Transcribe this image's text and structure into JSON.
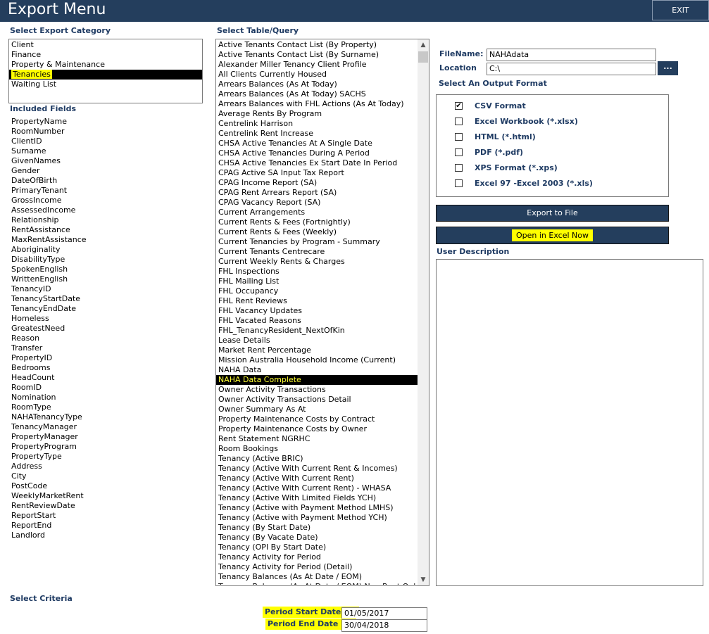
{
  "title": "Export Menu",
  "exit_label": "EXIT",
  "labels": {
    "category": "Select Export Category",
    "included": "Included Fields",
    "table": "Select Table/Query",
    "filename": "FileName:",
    "location": "Location",
    "output_format": "Select An Output Format",
    "user_description": "User Description",
    "criteria": "Select Criteria"
  },
  "categories": [
    "Client",
    "Finance",
    "Property & Maintenance",
    "Tenancies",
    "Waiting List"
  ],
  "selected_category": "Tenancies",
  "fields": [
    "PropertyName",
    "RoomNumber",
    "ClientID",
    "Surname",
    "GivenNames",
    "Gender",
    "DateOfBirth",
    "PrimaryTenant",
    "GrossIncome",
    "AssessedIncome",
    "Relationship",
    "RentAssistance",
    "MaxRentAssistance",
    "Aboriginality",
    "DisabilityType",
    "SpokenEnglish",
    "WrittenEnglish",
    "TenancyID",
    "TenancyStartDate",
    "TenancyEndDate",
    "Homeless",
    "GreatestNeed",
    "Reason",
    "Transfer",
    "PropertyID",
    "Bedrooms",
    "HeadCount",
    "RoomID",
    "Nomination",
    "RoomType",
    "NAHATenancyType",
    "TenancyManager",
    "PropertyManager",
    "PropertyProgram",
    "PropertyType",
    "Address",
    "City",
    "PostCode",
    "WeeklyMarketRent",
    "RentReviewDate",
    "ReportStart",
    "ReportEnd",
    "Landlord"
  ],
  "queries": [
    "Active Tenants Contact List (By Property)",
    "Active Tenants Contact List (By Surname)",
    "Alexander Miller Tenancy Client Profile",
    "All Clients Currently Housed",
    "Arrears Balances (As At Today)",
    "Arrears Balances (As At Today) SACHS",
    "Arrears Balances with FHL Actions (As At Today)",
    "Average Rents By Program",
    "Centrelink Harrison",
    "Centrelink Rent Increase",
    "CHSA Active Tenancies At A Single Date",
    "CHSA Active Tenancies During A Period",
    "CHSA Active Tenancies Ex Start Date In Period",
    "CPAG Active SA Input Tax Report",
    "CPAG Income Report (SA)",
    "CPAG Rent Arrears Report (SA)",
    "CPAG Vacancy Report (SA)",
    "Current Arrangements",
    "Current Rents & Fees (Fortnightly)",
    "Current Rents & Fees (Weekly)",
    "Current Tenancies by Program - Summary",
    "Current Tenants Centrecare",
    "Current Weekly Rents & Charges",
    "FHL Inspections",
    "FHL Mailing List",
    "FHL Occupancy",
    "FHL Rent Reviews",
    "FHL Vacancy Updates",
    "FHL Vacated Reasons",
    "FHL_TenancyResident_NextOfKin",
    "Lease Details",
    "Market Rent Percentage",
    "Mission Australia Household Income (Current)",
    "NAHA Data",
    "NAHA Data Complete",
    "Owner Activity Transactions",
    "Owner Activity Transactions Detail",
    "Owner Summary As At",
    "Property Maintenance Costs by Contract",
    "Property Maintenance Costs by Owner",
    "Rent Statement NGRHC",
    "Room Bookings",
    "Tenancy (Active BRIC)",
    "Tenancy (Active With Current Rent & Incomes)",
    "Tenancy (Active With Current Rent)",
    "Tenancy (Active With Current Rent) - WHASA",
    "Tenancy (Active With Limited Fields YCH)",
    "Tenancy (Active with Payment Method LMHS)",
    "Tenancy (Active with Payment Method YCH)",
    "Tenancy (By Start Date)",
    "Tenancy (By Vacate Date)",
    "Tenancy (OPI By Start Date)",
    "Tenancy Activity for Period",
    "Tenancy Activity for Period (Detail)",
    "Tenancy Balances (As At Date / EOM)",
    "Tenancy Balances (As At Date / EOM) Non Rent Only"
  ],
  "selected_query": "NAHA Data Complete",
  "filename": "NAHAdata",
  "location": "C:\\",
  "browse_label": "...",
  "formats": [
    {
      "label": "CSV Format",
      "checked": true
    },
    {
      "label": "Excel Workbook (*.xlsx)",
      "checked": false
    },
    {
      "label": "HTML (*.html)",
      "checked": false
    },
    {
      "label": "PDF (*.pdf)",
      "checked": false
    },
    {
      "label": "XPS Format (*.xps)",
      "checked": false
    },
    {
      "label": "Excel 97 -Excel 2003 (*.xls)",
      "checked": false
    }
  ],
  "check_mark": "✔",
  "buttons": {
    "export": "Export to File",
    "open_excel": "Open in Excel Now"
  },
  "criteria": {
    "start_label": "Period Start Date >=",
    "start_value": "01/05/2017",
    "end_label": "Period End Date <=",
    "end_value": "30/04/2018"
  },
  "colors": {
    "titlebar": "#243e5d",
    "highlight": "#ffff00",
    "label": "#1f3b63"
  }
}
